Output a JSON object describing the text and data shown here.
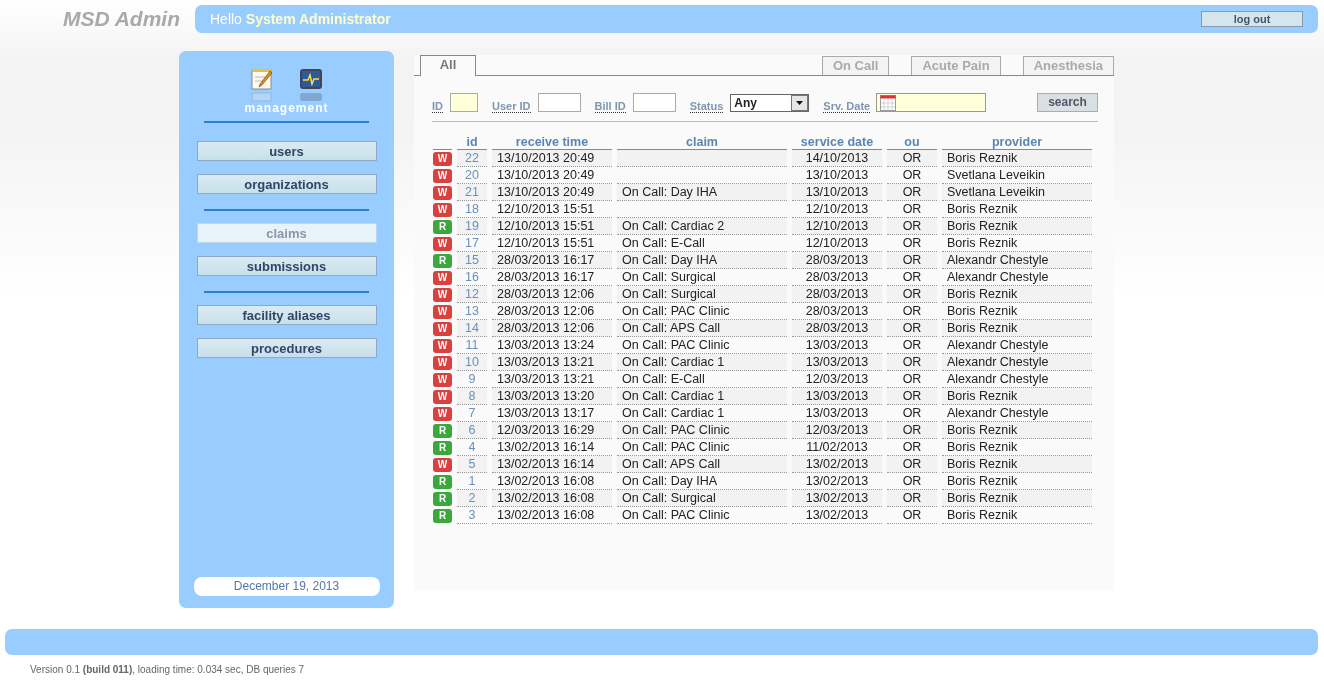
{
  "app_title": "MSD Admin",
  "greeting": {
    "prefix": "Hello",
    "user": "System Administrator"
  },
  "logout_button": "log out",
  "sidebar": {
    "section_label": "management",
    "groups": [
      [
        {
          "label": "users",
          "selected": false
        },
        {
          "label": "organizations",
          "selected": false
        }
      ],
      [
        {
          "label": "claims",
          "selected": true
        },
        {
          "label": "submissions",
          "selected": false
        }
      ],
      [
        {
          "label": "facility aliases",
          "selected": false
        },
        {
          "label": "procedures",
          "selected": false
        }
      ]
    ],
    "date": "December 19, 2013"
  },
  "tabs": [
    {
      "label": "All",
      "selected": true
    },
    {
      "label": "On Call",
      "selected": false
    },
    {
      "label": "Acute Pain",
      "selected": false
    },
    {
      "label": "Anesthesia",
      "selected": false
    }
  ],
  "filters": [
    {
      "kind": "text",
      "label": "ID",
      "highlighted": true
    },
    {
      "kind": "text",
      "label": "User ID",
      "highlighted": false
    },
    {
      "kind": "text",
      "label": "Bill ID",
      "highlighted": false
    },
    {
      "kind": "select",
      "label": "Status",
      "value": "Any",
      "highlighted": false
    },
    {
      "kind": "date",
      "label": "Srv. Date",
      "highlighted": true
    }
  ],
  "search_button": "search",
  "table": {
    "columns": [
      "id",
      "receive time",
      "claim",
      "service date",
      "ou",
      "provider"
    ],
    "rows": [
      {
        "status": "W",
        "color": "#d9413f",
        "cells": [
          "22",
          "13/10/2013 20:49",
          "",
          "14/10/2013",
          "OR",
          "Boris Reznik"
        ]
      },
      {
        "status": "W",
        "color": "#d9413f",
        "cells": [
          "20",
          "13/10/2013 20:49",
          "",
          "13/10/2013",
          "OR",
          "Svetlana Leveikin"
        ]
      },
      {
        "status": "W",
        "color": "#d9413f",
        "cells": [
          "21",
          "13/10/2013 20:49",
          "On Call: Day IHA",
          "13/10/2013",
          "OR",
          "Svetlana Leveikin"
        ]
      },
      {
        "status": "W",
        "color": "#d9413f",
        "cells": [
          "18",
          "12/10/2013 15:51",
          "",
          "12/10/2013",
          "OR",
          "Boris Reznik"
        ]
      },
      {
        "status": "R",
        "color": "#3aa83a",
        "cells": [
          "19",
          "12/10/2013 15:51",
          "On Call: Cardiac 2",
          "12/10/2013",
          "OR",
          "Boris Reznik"
        ]
      },
      {
        "status": "W",
        "color": "#d9413f",
        "cells": [
          "17",
          "12/10/2013 15:51",
          "On Call: E-Call",
          "12/10/2013",
          "OR",
          "Boris Reznik"
        ]
      },
      {
        "status": "R",
        "color": "#3aa83a",
        "cells": [
          "15",
          "28/03/2013 16:17",
          "On Call: Day IHA",
          "28/03/2013",
          "OR",
          "Alexandr Chestyle"
        ]
      },
      {
        "status": "W",
        "color": "#d9413f",
        "cells": [
          "16",
          "28/03/2013 16:17",
          "On Call: Surgical",
          "28/03/2013",
          "OR",
          "Alexandr Chestyle"
        ]
      },
      {
        "status": "W",
        "color": "#d9413f",
        "cells": [
          "12",
          "28/03/2013 12:06",
          "On Call: Surgical",
          "28/03/2013",
          "OR",
          "Boris Reznik"
        ]
      },
      {
        "status": "W",
        "color": "#d9413f",
        "cells": [
          "13",
          "28/03/2013 12:06",
          "On Call: PAC Clinic",
          "28/03/2013",
          "OR",
          "Boris Reznik"
        ]
      },
      {
        "status": "W",
        "color": "#d9413f",
        "cells": [
          "14",
          "28/03/2013 12:06",
          "On Call: APS Call",
          "28/03/2013",
          "OR",
          "Boris Reznik"
        ]
      },
      {
        "status": "W",
        "color": "#d9413f",
        "cells": [
          "11",
          "13/03/2013 13:24",
          "On Call: PAC Clinic",
          "13/03/2013",
          "OR",
          "Alexandr Chestyle"
        ]
      },
      {
        "status": "W",
        "color": "#d9413f",
        "cells": [
          "10",
          "13/03/2013 13:21",
          "On Call: Cardiac 1",
          "13/03/2013",
          "OR",
          "Alexandr Chestyle"
        ]
      },
      {
        "status": "W",
        "color": "#d9413f",
        "cells": [
          "9",
          "13/03/2013 13:21",
          "On Call: E-Call",
          "12/03/2013",
          "OR",
          "Alexandr Chestyle"
        ]
      },
      {
        "status": "W",
        "color": "#d9413f",
        "cells": [
          "8",
          "13/03/2013 13:20",
          "On Call: Cardiac 1",
          "13/03/2013",
          "OR",
          "Boris Reznik"
        ]
      },
      {
        "status": "W",
        "color": "#d9413f",
        "cells": [
          "7",
          "13/03/2013 13:17",
          "On Call: Cardiac 1",
          "13/03/2013",
          "OR",
          "Alexandr Chestyle"
        ]
      },
      {
        "status": "R",
        "color": "#3aa83a",
        "cells": [
          "6",
          "12/03/2013 16:29",
          "On Call: PAC Clinic",
          "12/03/2013",
          "OR",
          "Boris Reznik"
        ]
      },
      {
        "status": "R",
        "color": "#3aa83a",
        "cells": [
          "4",
          "13/02/2013 16:14",
          "On Call: PAC Clinic",
          "11/02/2013",
          "OR",
          "Boris Reznik"
        ]
      },
      {
        "status": "W",
        "color": "#d9413f",
        "cells": [
          "5",
          "13/02/2013 16:14",
          "On Call: APS Call",
          "13/02/2013",
          "OR",
          "Boris Reznik"
        ]
      },
      {
        "status": "R",
        "color": "#3aa83a",
        "cells": [
          "1",
          "13/02/2013 16:08",
          "On Call: Day IHA",
          "13/02/2013",
          "OR",
          "Boris Reznik"
        ]
      },
      {
        "status": "R",
        "color": "#3aa83a",
        "cells": [
          "2",
          "13/02/2013 16:08",
          "On Call: Surgical",
          "13/02/2013",
          "OR",
          "Boris Reznik"
        ]
      },
      {
        "status": "R",
        "color": "#3aa83a",
        "cells": [
          "3",
          "13/02/2013 16:08",
          "On Call: PAC Clinic",
          "13/02/2013",
          "OR",
          "Boris Reznik"
        ]
      }
    ]
  },
  "footer_text": "Version 0.1 **(build 011)**, loading time: 0.034 sec, DB queries 7"
}
